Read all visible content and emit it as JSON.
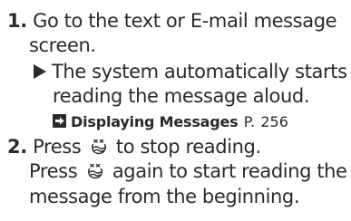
{
  "steps": [
    {
      "number": "1.",
      "text_line1": "Go to the text or E-mail message",
      "text_line2": "screen.",
      "result_line1": "The system automatically starts",
      "result_line2": "reading the message aloud.",
      "reference": {
        "label": "Displaying Messages",
        "page_prefix": "P.",
        "page": "256"
      }
    },
    {
      "number": "2.",
      "line1_before": "Press",
      "line1_after": "to stop reading.",
      "line2_before": "Press",
      "line2_after": "again to start reading the",
      "line3": "message from the beginning."
    }
  ],
  "icons": {
    "result_marker": "triangle-right-icon",
    "reference_marker": "reference-arrow-icon",
    "talk_button": "talk-button-icon"
  }
}
